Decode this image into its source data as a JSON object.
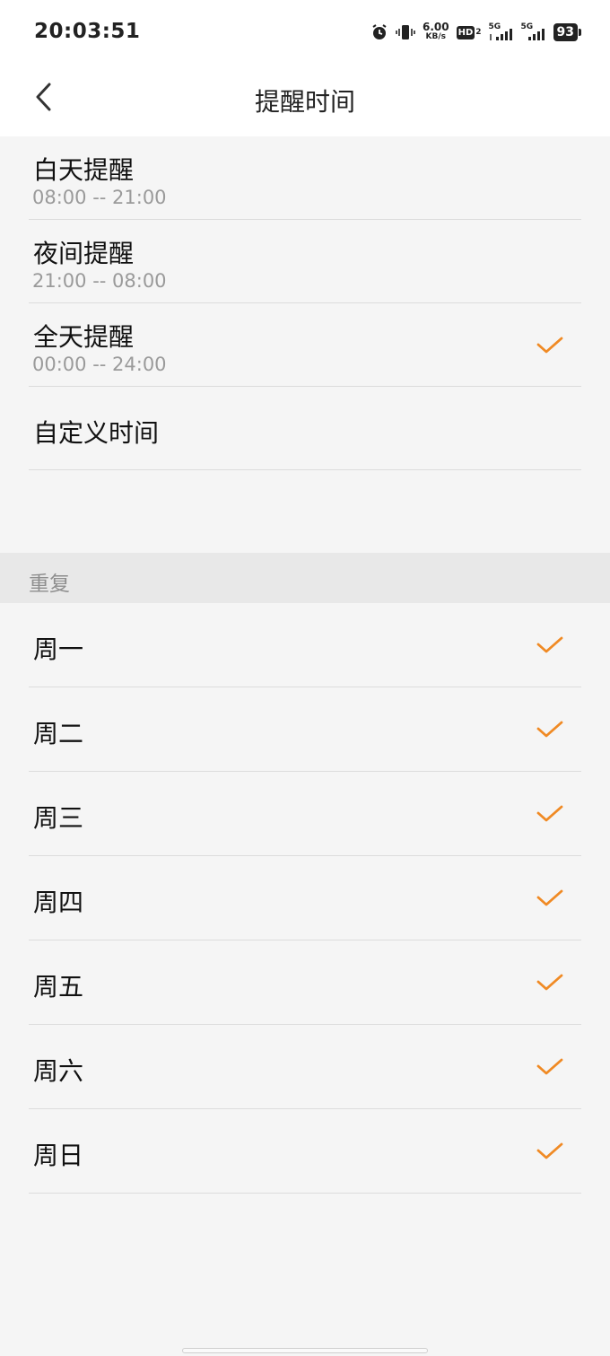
{
  "status_bar": {
    "time": "20:03:51",
    "speed_value": "6.00",
    "speed_unit": "KB/s",
    "hd_label": "HD",
    "hd_sub": "2",
    "net1_label": "5G",
    "net2_label": "5G",
    "battery": "93"
  },
  "header": {
    "title": "提醒时间"
  },
  "time_options": [
    {
      "title": "白天提醒",
      "range": "08:00 -- 21:00",
      "checked": false
    },
    {
      "title": "夜间提醒",
      "range": "21:00 -- 08:00",
      "checked": false
    },
    {
      "title": "全天提醒",
      "range": "00:00 -- 24:00",
      "checked": true
    },
    {
      "title": "自定义时间",
      "range": "",
      "checked": false
    }
  ],
  "repeat": {
    "header": "重复",
    "days": [
      {
        "label": "周一",
        "checked": true
      },
      {
        "label": "周二",
        "checked": true
      },
      {
        "label": "周三",
        "checked": true
      },
      {
        "label": "周四",
        "checked": true
      },
      {
        "label": "周五",
        "checked": true
      },
      {
        "label": "周六",
        "checked": true
      },
      {
        "label": "周日",
        "checked": true
      }
    ]
  },
  "colors": {
    "accent": "#f08a24",
    "background": "#f5f5f5",
    "header_bg": "#ffffff",
    "section_bg": "#e8e8e8"
  },
  "icons": {
    "back": "chevron-left-icon",
    "check": "checkmark-icon",
    "alarm": "alarm-icon",
    "vibrate": "vibrate-icon",
    "signal": "signal-icon"
  }
}
